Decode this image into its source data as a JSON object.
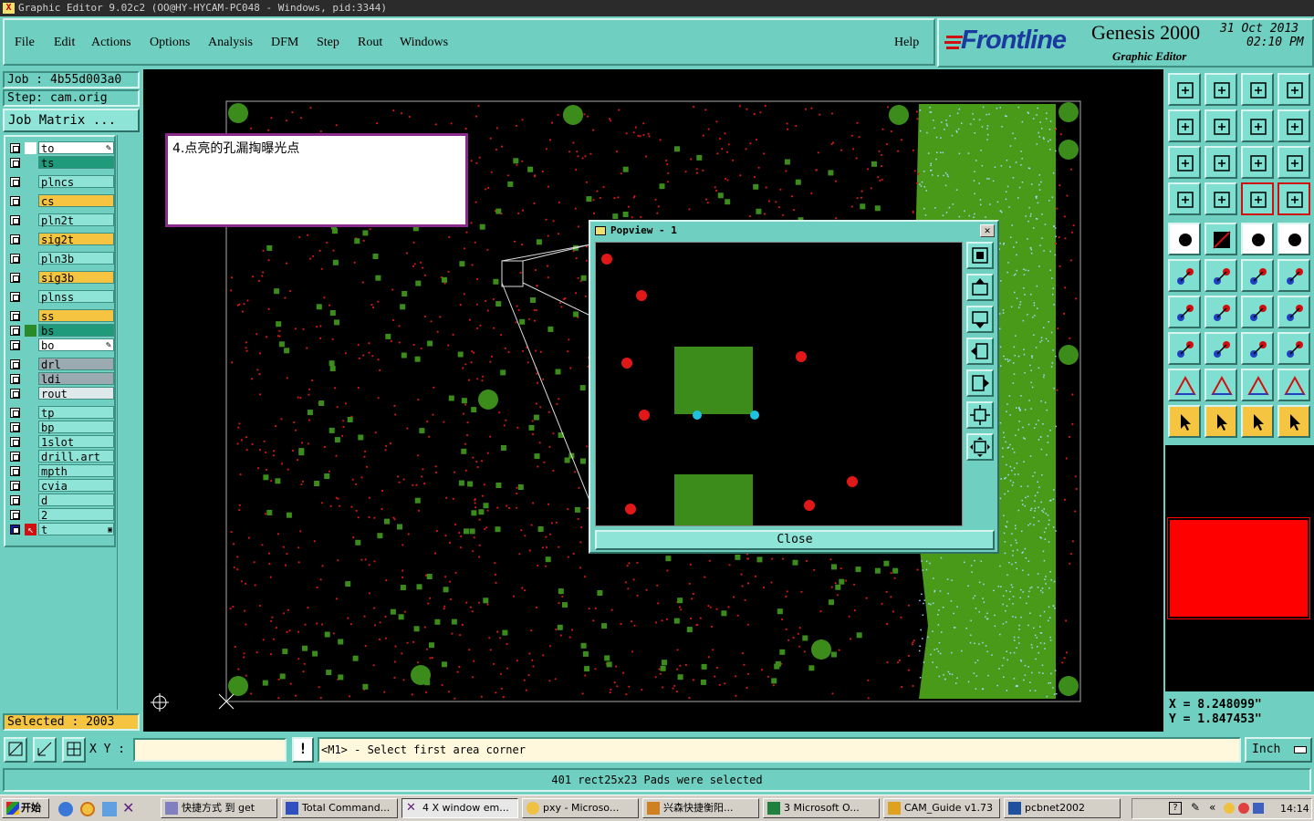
{
  "window": {
    "title": "Graphic Editor 9.02c2  (OO@HY-HYCAM-PC048 - Windows, pid:3344)"
  },
  "menu": {
    "items": [
      "File",
      "Edit",
      "Actions",
      "Options",
      "Analysis",
      "DFM",
      "Step",
      "Rout",
      "Windows"
    ],
    "help": "Help"
  },
  "logo": {
    "brand": "Frontline",
    "product": "Genesis 2000",
    "subtitle": "Graphic Editor",
    "date": "31 Oct 2013",
    "time": "02:10 PM"
  },
  "job": {
    "job_label": "Job : 4b55d003a0",
    "step_label": "Step: cam.orig",
    "matrix_button": "Job Matrix ..."
  },
  "layers": [
    {
      "name": "to",
      "color": "#ffffff",
      "swatch": "#ffffff",
      "edit": true
    },
    {
      "name": "ts",
      "color": "#1f9a7a",
      "swatch": "#6fcfc0"
    },
    {
      "name": "plncs",
      "color": "#8fe4d8",
      "swatch": "#6fcfc0"
    },
    {
      "name": "cs",
      "color": "#f5c542",
      "swatch": "#6fcfc0"
    },
    {
      "name": "pln2t",
      "color": "#8fe4d8",
      "swatch": "#6fcfc0"
    },
    {
      "name": "sig2t",
      "color": "#f5c542",
      "swatch": "#6fcfc0"
    },
    {
      "name": "pln3b",
      "color": "#8fe4d8",
      "swatch": "#6fcfc0"
    },
    {
      "name": "sig3b",
      "color": "#f5c542",
      "swatch": "#6fcfc0"
    },
    {
      "name": "plnss",
      "color": "#8fe4d8",
      "swatch": "#6fcfc0"
    },
    {
      "name": "ss",
      "color": "#f5c542",
      "swatch": "#6fcfc0"
    },
    {
      "name": "bs",
      "color": "#1f9a7a",
      "swatch": "#2a8a2a"
    },
    {
      "name": "bo",
      "color": "#ffffff",
      "swatch": "#6fcfc0",
      "edit": true
    },
    {
      "name": "drl",
      "color": "#9aaab0",
      "swatch": "#6fcfc0"
    },
    {
      "name": "ldi",
      "color": "#9aaab0",
      "swatch": "#6fcfc0"
    },
    {
      "name": "rout",
      "color": "#dfe8ea",
      "swatch": "#6fcfc0"
    },
    {
      "name": "tp",
      "color": "#8fe4d8",
      "swatch": "#6fcfc0"
    },
    {
      "name": "bp",
      "color": "#8fe4d8",
      "swatch": "#6fcfc0"
    },
    {
      "name": "1slot",
      "color": "#8fe4d8",
      "swatch": "#6fcfc0"
    },
    {
      "name": "drill.art",
      "color": "#8fe4d8",
      "swatch": "#6fcfc0"
    },
    {
      "name": "mpth",
      "color": "#8fe4d8",
      "swatch": "#6fcfc0"
    },
    {
      "name": "cvia",
      "color": "#8fe4d8",
      "swatch": "#6fcfc0"
    },
    {
      "name": "d",
      "color": "#8fe4d8",
      "swatch": "#6fcfc0"
    },
    {
      "name": "2",
      "color": "#8fe4d8",
      "swatch": "#6fcfc0"
    },
    {
      "name": "t",
      "color": "#8fe4d8",
      "swatch": "#d01010",
      "active": true
    }
  ],
  "selected": {
    "label": "Selected : 2003"
  },
  "note": {
    "text": "4.点亮的孔漏掏曝光点"
  },
  "popview": {
    "title": "Popview - 1",
    "close_label": "Close"
  },
  "coords": {
    "x": "X = 8.248099\"",
    "y": "Y = 1.847453\""
  },
  "cmd": {
    "xy_label": "X Y :",
    "xy_value": "",
    "prompt": "<M1> - Select first area corner",
    "units": "Inch"
  },
  "status": {
    "message": "401 rect25x23 Pads were selected"
  },
  "taskbar": {
    "start": "开始",
    "tasks": [
      "快捷方式 到 get",
      "Total Command...",
      "4 X window em...",
      "pxy - Microso...",
      "兴森快捷衡阳...",
      "3 Microsoft O...",
      "CAM_Guide v1.73",
      "pcbnet2002"
    ],
    "clock": "14:14"
  },
  "colors": {
    "background": "#6fcfc0",
    "canvas": "#000000",
    "copper": "#3c8c1c",
    "drill": "#e01818",
    "highlight": "#20c0e0"
  }
}
